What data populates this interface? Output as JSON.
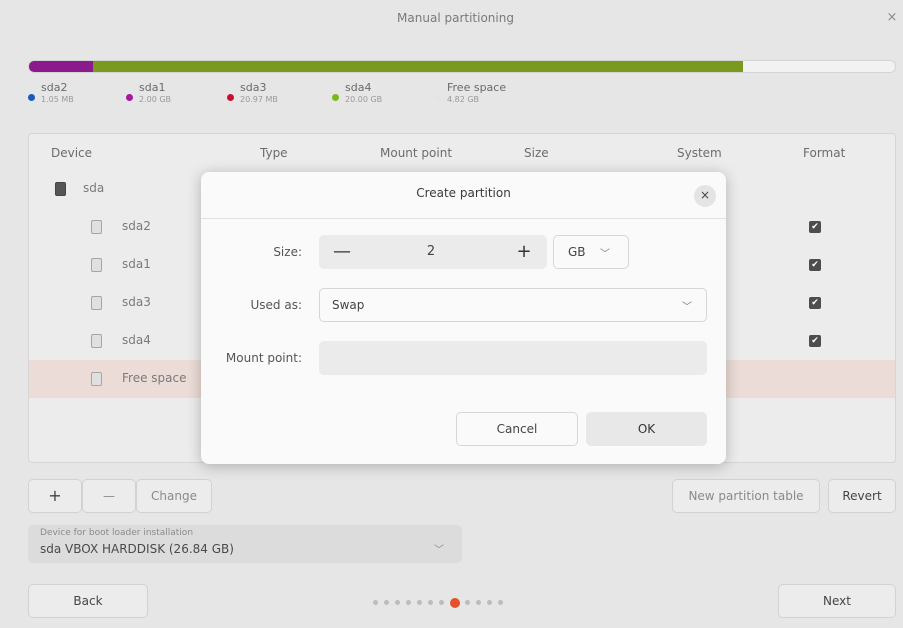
{
  "window": {
    "title": "Manual partitioning",
    "close_glyph": "×"
  },
  "usage_bar": {
    "segments": [
      {
        "name": "sda2",
        "color": "#8b1a8c"
      },
      {
        "name": "sda1",
        "color": "#7a9a1f"
      },
      {
        "name": "Free space",
        "color": "#f2f2f2"
      }
    ]
  },
  "legend": [
    {
      "name": "sda2",
      "size": "1.05 MB",
      "color": "#1c5bb8"
    },
    {
      "name": "sda1",
      "size": "2.00 GB",
      "color": "#a21aa0"
    },
    {
      "name": "sda3",
      "size": "20.97 MB",
      "color": "#c8102e"
    },
    {
      "name": "sda4",
      "size": "20.00 GB",
      "color": "#7bb81f"
    },
    {
      "name": "Free space",
      "size": "4.82 GB",
      "color": "#e4e4e4"
    }
  ],
  "table": {
    "headers": [
      "Device",
      "Type",
      "Mount point",
      "Size",
      "System",
      "Format"
    ],
    "rows": [
      {
        "label": "sda",
        "kind": "disk"
      },
      {
        "label": "sda2",
        "kind": "partition",
        "format": true
      },
      {
        "label": "sda1",
        "kind": "partition",
        "format": true
      },
      {
        "label": "sda3",
        "kind": "partition",
        "format": true
      },
      {
        "label": "sda4",
        "kind": "partition",
        "format": true
      },
      {
        "label": "Free space",
        "kind": "free",
        "format": false
      }
    ],
    "check_glyph": "✔"
  },
  "toolbar": {
    "add_label": "+",
    "remove_label": "—",
    "change_label": "Change",
    "new_table_label": "New partition table",
    "revert_label": "Revert"
  },
  "bootloader": {
    "label": "Device for boot loader installation",
    "value": "sda VBOX HARDDISK (26.84 GB)",
    "chevron": "﹀"
  },
  "navigation": {
    "back_label": "Back",
    "next_label": "Next",
    "page_count": 12,
    "current_page": 8
  },
  "dialog": {
    "title": "Create partition",
    "close_glyph": "×",
    "size_label": "Size:",
    "size_value": "2",
    "minus_glyph": "—",
    "plus_glyph": "+",
    "unit_value": "GB",
    "used_as_label": "Used as:",
    "used_as_value": "Swap",
    "chevron": "﹀",
    "mount_point_label": "Mount point:",
    "mount_point_value": "",
    "cancel_label": "Cancel",
    "ok_label": "OK"
  }
}
